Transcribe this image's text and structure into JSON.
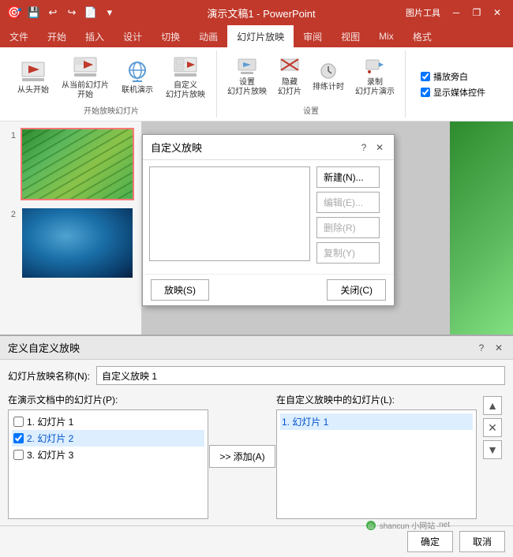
{
  "titlebar": {
    "title": "演示文稿1 - PowerPoint",
    "tools_label": "图片工具",
    "save_icon": "💾",
    "undo_icon": "↩",
    "redo_icon": "↪",
    "new_icon": "📄",
    "dropdown_icon": "▾",
    "min_icon": "─",
    "restore_icon": "❐",
    "close_icon": "✕"
  },
  "ribbon": {
    "tabs": [
      {
        "label": "文件",
        "active": false
      },
      {
        "label": "开始",
        "active": false
      },
      {
        "label": "插入",
        "active": false
      },
      {
        "label": "设计",
        "active": false
      },
      {
        "label": "切换",
        "active": false
      },
      {
        "label": "动画",
        "active": false
      },
      {
        "label": "幻灯片放映",
        "active": true
      },
      {
        "label": "审阅",
        "active": false
      },
      {
        "label": "视图",
        "active": false
      },
      {
        "label": "Mix",
        "active": false
      },
      {
        "label": "格式",
        "active": false
      }
    ],
    "groups": [
      {
        "label": "开始放映幻灯片",
        "items": [
          {
            "icon": "▶",
            "label": "从头开始",
            "name": "start-from-beginning"
          },
          {
            "icon": "⏯",
            "label": "从当前幻灯片\n开始",
            "name": "start-from-current"
          },
          {
            "icon": "📡",
            "label": "联机演示",
            "name": "online-present"
          },
          {
            "icon": "🎞",
            "label": "自定义\n幻灯片放映",
            "name": "custom-slideshow"
          }
        ]
      },
      {
        "label": "设置",
        "items": [
          {
            "icon": "⚙",
            "label": "设置\n幻灯片放映",
            "name": "setup-slideshow"
          },
          {
            "icon": "🙈",
            "label": "隐藏\n幻灯片",
            "name": "hide-slide"
          },
          {
            "icon": "⏱",
            "label": "排练计时",
            "name": "rehearse-timing"
          },
          {
            "icon": "🎥",
            "label": "录制\n幻灯片演示",
            "name": "record-slideshow"
          }
        ]
      },
      {
        "label": "checkboxes",
        "checkboxes": [
          {
            "label": "播放旁白",
            "checked": true
          },
          {
            "label": "显示媒体控件",
            "checked": true
          }
        ]
      }
    ]
  },
  "slides": [
    {
      "num": "1",
      "active": true
    },
    {
      "num": "2",
      "active": false
    }
  ],
  "custom_show_dialog": {
    "title": "自定义放映",
    "question_icon": "?",
    "close_icon": "✕",
    "buttons": [
      {
        "label": "新建(N)...",
        "name": "new-btn",
        "disabled": false
      },
      {
        "label": "编辑(E)...",
        "name": "edit-btn",
        "disabled": true
      },
      {
        "label": "删除(R)",
        "name": "delete-btn",
        "disabled": true
      },
      {
        "label": "复制(Y)",
        "name": "copy-btn",
        "disabled": true
      }
    ],
    "play_btn": "放映(S)",
    "close_btn": "关闭(C)"
  },
  "define_dialog": {
    "title": "定义自定义放映",
    "question_icon": "?",
    "close_icon": "✕",
    "name_label": "幻灯片放映名称(N):",
    "name_value": "自定义放映 1",
    "left_list_label": "在演示文档中的幻灯片(P):",
    "left_items": [
      {
        "label": "1. 幻灯片 1",
        "checked": false
      },
      {
        "label": "2. 幻灯片 2",
        "checked": true
      },
      {
        "label": "3. 幻灯片 3",
        "checked": false
      }
    ],
    "right_list_label": "在自定义放映中的幻灯片(L):",
    "right_items": [
      {
        "label": "1. 幻灯片 1",
        "selected": true
      }
    ],
    "add_btn": ">> 添加(A)",
    "up_icon": "▲",
    "delete_icon": "✕",
    "down_icon": "▼",
    "ok_btn": "确定",
    "cancel_btn": "取消"
  },
  "watermark": {
    "text": "shancun 小网站",
    "url": "net"
  }
}
